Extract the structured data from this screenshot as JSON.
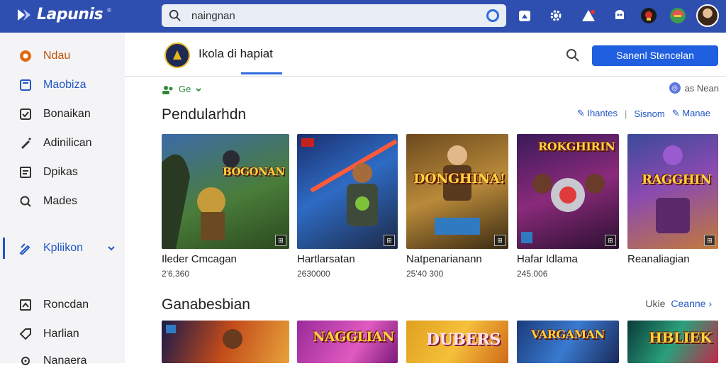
{
  "header": {
    "logo_text": "Lapunis",
    "logo_tm": "®",
    "search": {
      "value": "naingnan",
      "placeholder": ""
    },
    "icons": [
      "home-icon",
      "gear-icon",
      "notification-icon",
      "chat-icon",
      "game-badge-icon",
      "colorful-icon",
      "avatar"
    ]
  },
  "sidebar": {
    "items": [
      {
        "label": "Ndau",
        "icon": "flame-icon",
        "color": "orange"
      },
      {
        "label": "Maobiza",
        "icon": "bookmark-icon",
        "color": "blue"
      },
      {
        "label": "Bonaikan",
        "icon": "check-square-icon",
        "color": "default"
      },
      {
        "label": "Adinilican",
        "icon": "pen-icon",
        "color": "default"
      },
      {
        "label": "Dpikas",
        "icon": "list-icon",
        "color": "default"
      },
      {
        "label": "Mades",
        "icon": "search-icon",
        "color": "default"
      },
      {
        "label": "Kpliikon",
        "icon": "edit-icon",
        "color": "default",
        "expandable": true
      },
      {
        "label": "Roncdan",
        "icon": "chart-icon",
        "color": "default"
      },
      {
        "label": "Harlian",
        "icon": "tag-icon",
        "color": "default"
      },
      {
        "label": "Nanaera",
        "icon": "settings-icon",
        "color": "default"
      }
    ]
  },
  "main": {
    "tab_title": "Ikola di hapiat",
    "primary_button": "Sanenl Stencelan",
    "status_label": "Ge",
    "meta_right": "as Nean",
    "section1": {
      "title": "Pendularhdn",
      "links": [
        "Ihantes",
        "Sisnom",
        "Manae"
      ],
      "cards": [
        {
          "title": "Ileder Cmcagan",
          "sub": "2'6,360",
          "banner": "BOGONAN"
        },
        {
          "title": "Hartlarsatan",
          "sub": "2630000",
          "banner": ""
        },
        {
          "title": "Natpenarianann",
          "sub": "25'40 300",
          "banner": "DONGHINA!"
        },
        {
          "title": "Hafar Idlama",
          "sub": "245.006",
          "banner": "ROKGHIRIN"
        },
        {
          "title": "Reanaliagian",
          "sub": "",
          "banner": "RAGGHIN"
        }
      ]
    },
    "section2": {
      "title": "Ganabesbian",
      "more_prefix": "Ukie",
      "more_link": "Ceanne ›",
      "cards": [
        {
          "banner": ""
        },
        {
          "banner": "NAGGLIAN"
        },
        {
          "banner": "DUBERS"
        },
        {
          "banner": "VARGAMAN"
        },
        {
          "banner": "HBLIEK"
        }
      ]
    }
  },
  "colors": {
    "topbar": "#2f4fb0",
    "accent": "#1f5fe0",
    "sidebar_bg": "#f4f4f6",
    "orange": "#c0510a",
    "green": "#2e8a3a"
  }
}
